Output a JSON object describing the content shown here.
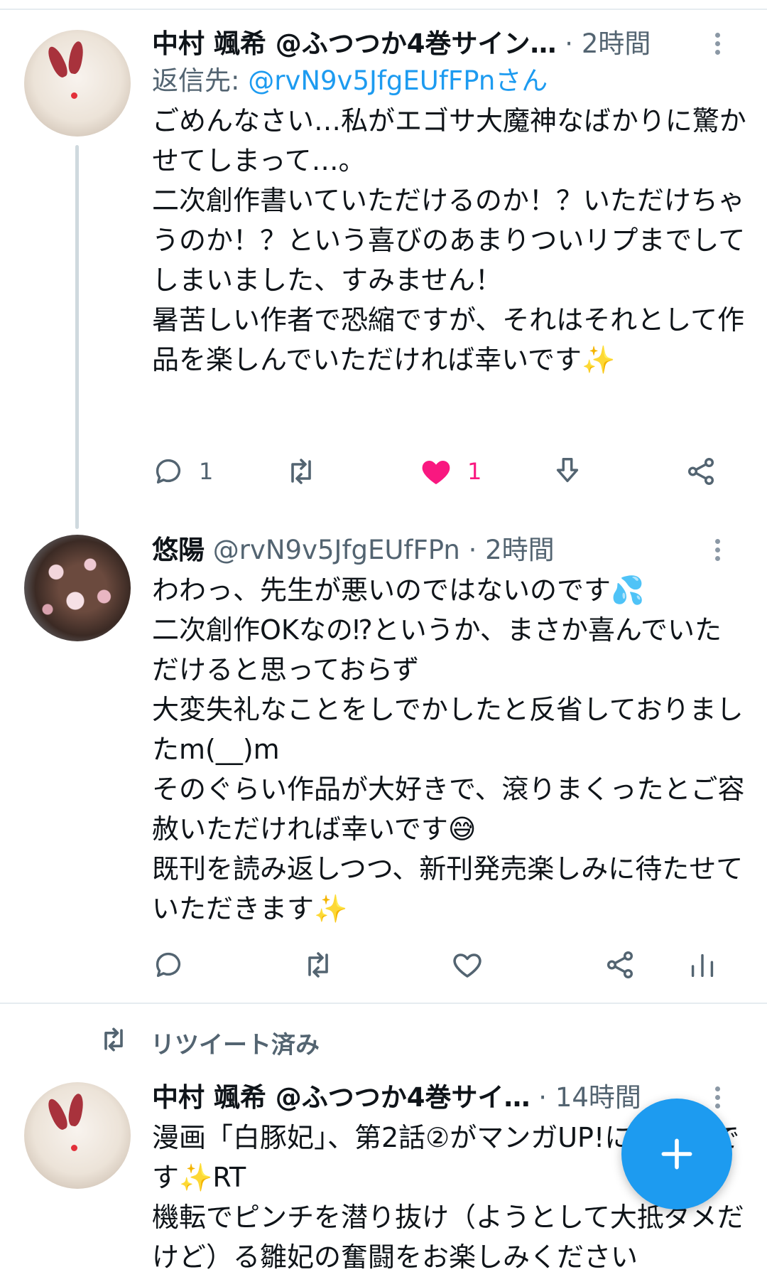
{
  "tweets": [
    {
      "author_name": "中村 颯希 @ふつつか4巻サイン…",
      "separator": "·",
      "time": "2時間",
      "reply_prefix": "返信先: ",
      "reply_mention": "@rvN9v5JfgEUfFPnさん",
      "text": "ごめんなさい…私がエゴサ大魔神なばかりに驚かせてしまって…。\n二次創作書いていただけるのか！？いただけちゃうのか！？という喜びのあまりついリプまでしてしまいました、すみません！\n暑苦しい作者で恐縮ですが、それはそれとして作品を楽しんでいただければ幸いです✨",
      "reply_count": "1",
      "like_count": "1",
      "liked": true
    },
    {
      "author_name": "悠陽",
      "handle": "@rvN9v5JfgEUfFPn",
      "separator": "·",
      "time": "2時間",
      "text": "わわっ、先生が悪いのではないのです💦\n二次創作OKなの⁉というか、まさか喜んでいただけると思っておらず\n大変失礼なことをしでかしたと反省しておりましたm(__)m\nそのぐらい作品が大好きで、滾りまくったとご容赦いただければ幸いです😅\n既刊を読み返しつつ、新刊発売楽しみに待たせていただきます✨"
    },
    {
      "retweet_label": "リツイート済み",
      "author_name": "中村 颯希 @ふつつか4巻サイ…",
      "separator": "·",
      "time": "14時間",
      "text": "漫画「白豚妃」、第2話②がマンガUP!にて更新です✨RT\n機転でピンチを潜り抜け（ようとして大抵ダメだけど）る雛妃の奮闘をお楽しみください"
    }
  ],
  "colors": {
    "accent": "#1d9bf0",
    "like": "#f91880",
    "secondary_text": "#536471"
  },
  "icons": [
    "reply-icon",
    "retweet-icon",
    "heart-icon",
    "download-icon",
    "share-icon",
    "analytics-icon",
    "more-icon",
    "compose-plus-icon"
  ]
}
